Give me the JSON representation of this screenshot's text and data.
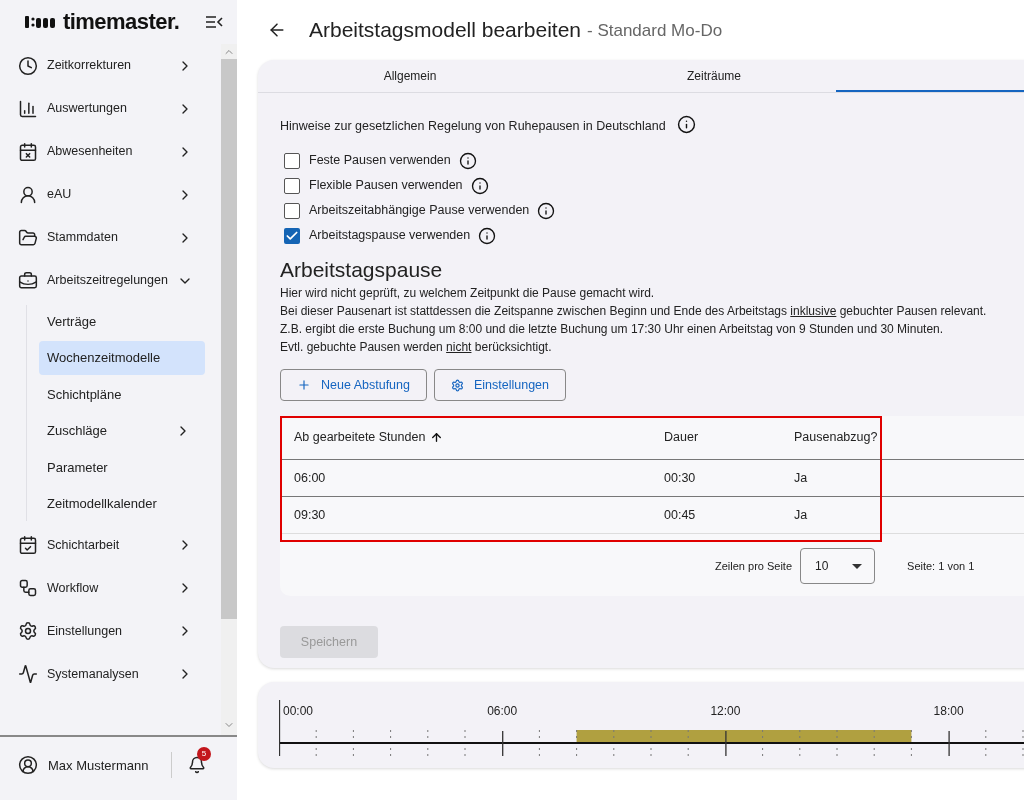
{
  "sidebar": {
    "logo": "timemaster.",
    "items": [
      {
        "label": "Zeitkorrekturen",
        "expanded": false
      },
      {
        "label": "Auswertungen",
        "expanded": false
      },
      {
        "label": "Abwesenheiten",
        "expanded": false
      },
      {
        "label": "eAU",
        "expanded": false
      },
      {
        "label": "Stammdaten",
        "expanded": false
      },
      {
        "label": "Arbeitszeitregelungen",
        "expanded": true,
        "children": [
          {
            "label": "Verträge",
            "kind": "link",
            "selected": false
          },
          {
            "label": "Wochenzeitmodelle",
            "kind": "link",
            "selected": true
          },
          {
            "label": "Schichtpläne",
            "kind": "link",
            "selected": false
          },
          {
            "label": "Zuschläge",
            "kind": "group",
            "selected": false
          },
          {
            "label": "Parameter",
            "kind": "link",
            "selected": false
          },
          {
            "label": "Zeitmodellkalender",
            "kind": "link",
            "selected": false
          }
        ]
      },
      {
        "label": "Schichtarbeit",
        "expanded": false
      },
      {
        "label": "Workflow",
        "expanded": false
      },
      {
        "label": "Einstellungen",
        "expanded": false
      },
      {
        "label": "Systemanalysen",
        "expanded": false
      }
    ],
    "user": {
      "name": "Max Mustermann",
      "notifications": "5"
    }
  },
  "header": {
    "title": "Arbeitstagsmodell bearbeiten",
    "subtitle": "- Standard Mo-Do"
  },
  "tabs": [
    {
      "label": "Allgemein",
      "selected": false
    },
    {
      "label": "Zeiträume",
      "selected": false
    },
    {
      "selected": true
    }
  ],
  "notice": "Hinweise zur gesetzlichen Regelung von Ruhepausen in Deutschland",
  "options": [
    {
      "label": "Feste Pausen verwenden",
      "checked": false
    },
    {
      "label": "Flexible Pausen verwenden",
      "checked": false
    },
    {
      "label": "Arbeitszeitabhängige Pause verwenden",
      "checked": false
    },
    {
      "label": "Arbeitstagspause verwenden",
      "checked": true
    }
  ],
  "section": {
    "title": "Arbeitstagspause",
    "paragraphs": [
      "Hier wird nicht geprüft, zu welchem Zeitpunkt die Pause gemacht wird.",
      [
        {
          "text": "Bei dieser Pausenart ist stattdessen die Zeitspanne zwischen Beginn und Ende des Arbeitstags ",
          "underline": false
        },
        {
          "text": "inklusive",
          "underline": true
        },
        {
          "text": " gebuchter Pausen relevant.",
          "underline": false
        }
      ],
      "Z.B. ergibt die erste Buchung um 8:00 und die letzte Buchung um 17:30 Uhr einen Arbeitstag von 9 Stunden und 30 Minuten.",
      [
        {
          "text": "Evtl. gebuchte Pausen werden ",
          "underline": false
        },
        {
          "text": "nicht",
          "underline": true
        },
        {
          "text": " berücksichtigt.",
          "underline": false
        }
      ]
    ]
  },
  "buttons": [
    {
      "label": "Neue Abstufung",
      "kind": "add"
    },
    {
      "label": "Einstellungen",
      "kind": "settings"
    }
  ],
  "table": {
    "columns": [
      "Ab gearbeitete Stunden",
      "Dauer",
      "Pausenabzug?"
    ],
    "rows": [
      [
        "06:00",
        "00:30",
        "Ja"
      ],
      [
        "09:30",
        "00:45",
        "Ja"
      ]
    ],
    "rows_per_page_label": "Zeilen pro Seite",
    "rows_per_page": "10",
    "page_info": "Seite: 1 von 1"
  },
  "save_button": {
    "label": "Speichern",
    "disabled": true
  },
  "timeline": {
    "labels": [
      "00:00",
      "06:00",
      "12:00",
      "18:00"
    ]
  }
}
